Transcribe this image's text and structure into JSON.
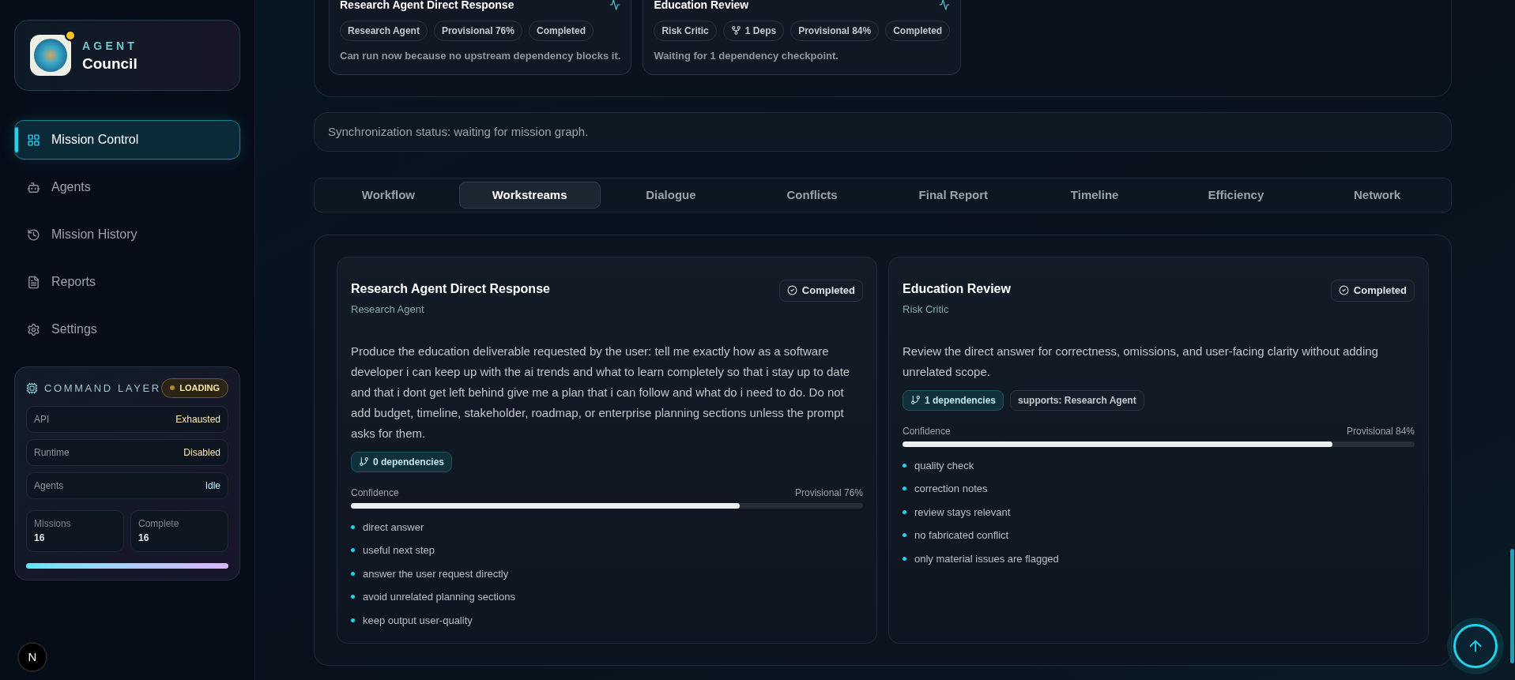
{
  "sidebar": {
    "brand": {
      "eyebrow": "AGENT",
      "name": "Council",
      "online": true
    },
    "nav": [
      {
        "label": "Mission Control",
        "selected": true
      },
      {
        "label": "Agents",
        "selected": false
      },
      {
        "label": "Mission History",
        "selected": false
      },
      {
        "label": "Reports",
        "selected": false
      },
      {
        "label": "Settings",
        "selected": false
      }
    ],
    "command_layer": {
      "title": "COMMAND LAYER",
      "badge": "LOADING",
      "rows": [
        {
          "label": "API",
          "value": "Exhausted",
          "kind": "warn"
        },
        {
          "label": "Runtime",
          "value": "Disabled",
          "kind": "warn"
        },
        {
          "label": "Agents",
          "value": "Idle",
          "kind": "info"
        }
      ],
      "stats": [
        {
          "label": "Missions",
          "value": "16"
        },
        {
          "label": "Complete",
          "value": "16"
        }
      ]
    },
    "footer_badge": "N"
  },
  "top_workstreams": [
    {
      "title": "Research Agent Direct Response",
      "tags": [
        {
          "kind": "text",
          "label": "Research Agent"
        },
        {
          "kind": "text",
          "label": "Provisional 76%"
        },
        {
          "kind": "text",
          "label": "Completed"
        }
      ],
      "note": "Can run now because no upstream dependency blocks it."
    },
    {
      "title": "Education Review",
      "tags": [
        {
          "kind": "text",
          "label": "Risk Critic"
        },
        {
          "kind": "deps",
          "label": "1 Deps"
        },
        {
          "kind": "text",
          "label": "Provisional 84%"
        },
        {
          "kind": "text",
          "label": "Completed"
        }
      ],
      "note": "Waiting for 1 dependency checkpoint."
    }
  ],
  "sync_status": "Synchronization status: waiting for mission graph.",
  "tabs": [
    {
      "label": "Workflow",
      "selected": false
    },
    {
      "label": "Workstreams",
      "selected": true
    },
    {
      "label": "Dialogue",
      "selected": false
    },
    {
      "label": "Conflicts",
      "selected": false
    },
    {
      "label": "Final Report",
      "selected": false
    },
    {
      "label": "Timeline",
      "selected": false
    },
    {
      "label": "Efficiency",
      "selected": false
    },
    {
      "label": "Network",
      "selected": false
    }
  ],
  "workstreams": [
    {
      "title": "Research Agent Direct Response",
      "agent": "Research Agent",
      "status": "Completed",
      "description": "Produce the education deliverable requested by the user: tell me exactly how as a software developer i can keep up with the ai trends and what to learn completely so that i stay up to date and that i dont get left behind give me a plan that i can follow and what do i need to do. Do not add budget, timeline, stakeholder, roadmap, or enterprise planning sections unless the prompt asks for them.",
      "dependencies": "0 dependencies",
      "confidence_label": "Confidence",
      "confidence_reading": "Provisional 76%",
      "level": 0.76,
      "items": [
        "direct answer",
        "useful next step",
        "answer the user request directly",
        "avoid unrelated planning sections",
        "keep output user-quality"
      ]
    },
    {
      "title": "Education Review",
      "agent": "Risk Critic",
      "status": "Completed",
      "description": "Review the direct answer for correctness, omissions, and user-facing clarity without adding unrelated scope.",
      "dependencies": "1 dependencies",
      "supports": [
        "supports: Research Agent"
      ],
      "confidence_label": "Confidence",
      "confidence_reading": "Provisional 84%",
      "level": 0.84,
      "items": [
        "quality check",
        "correction notes",
        "review stays relevant",
        "no fabricated conflict",
        "only material issues are flagged"
      ]
    }
  ]
}
